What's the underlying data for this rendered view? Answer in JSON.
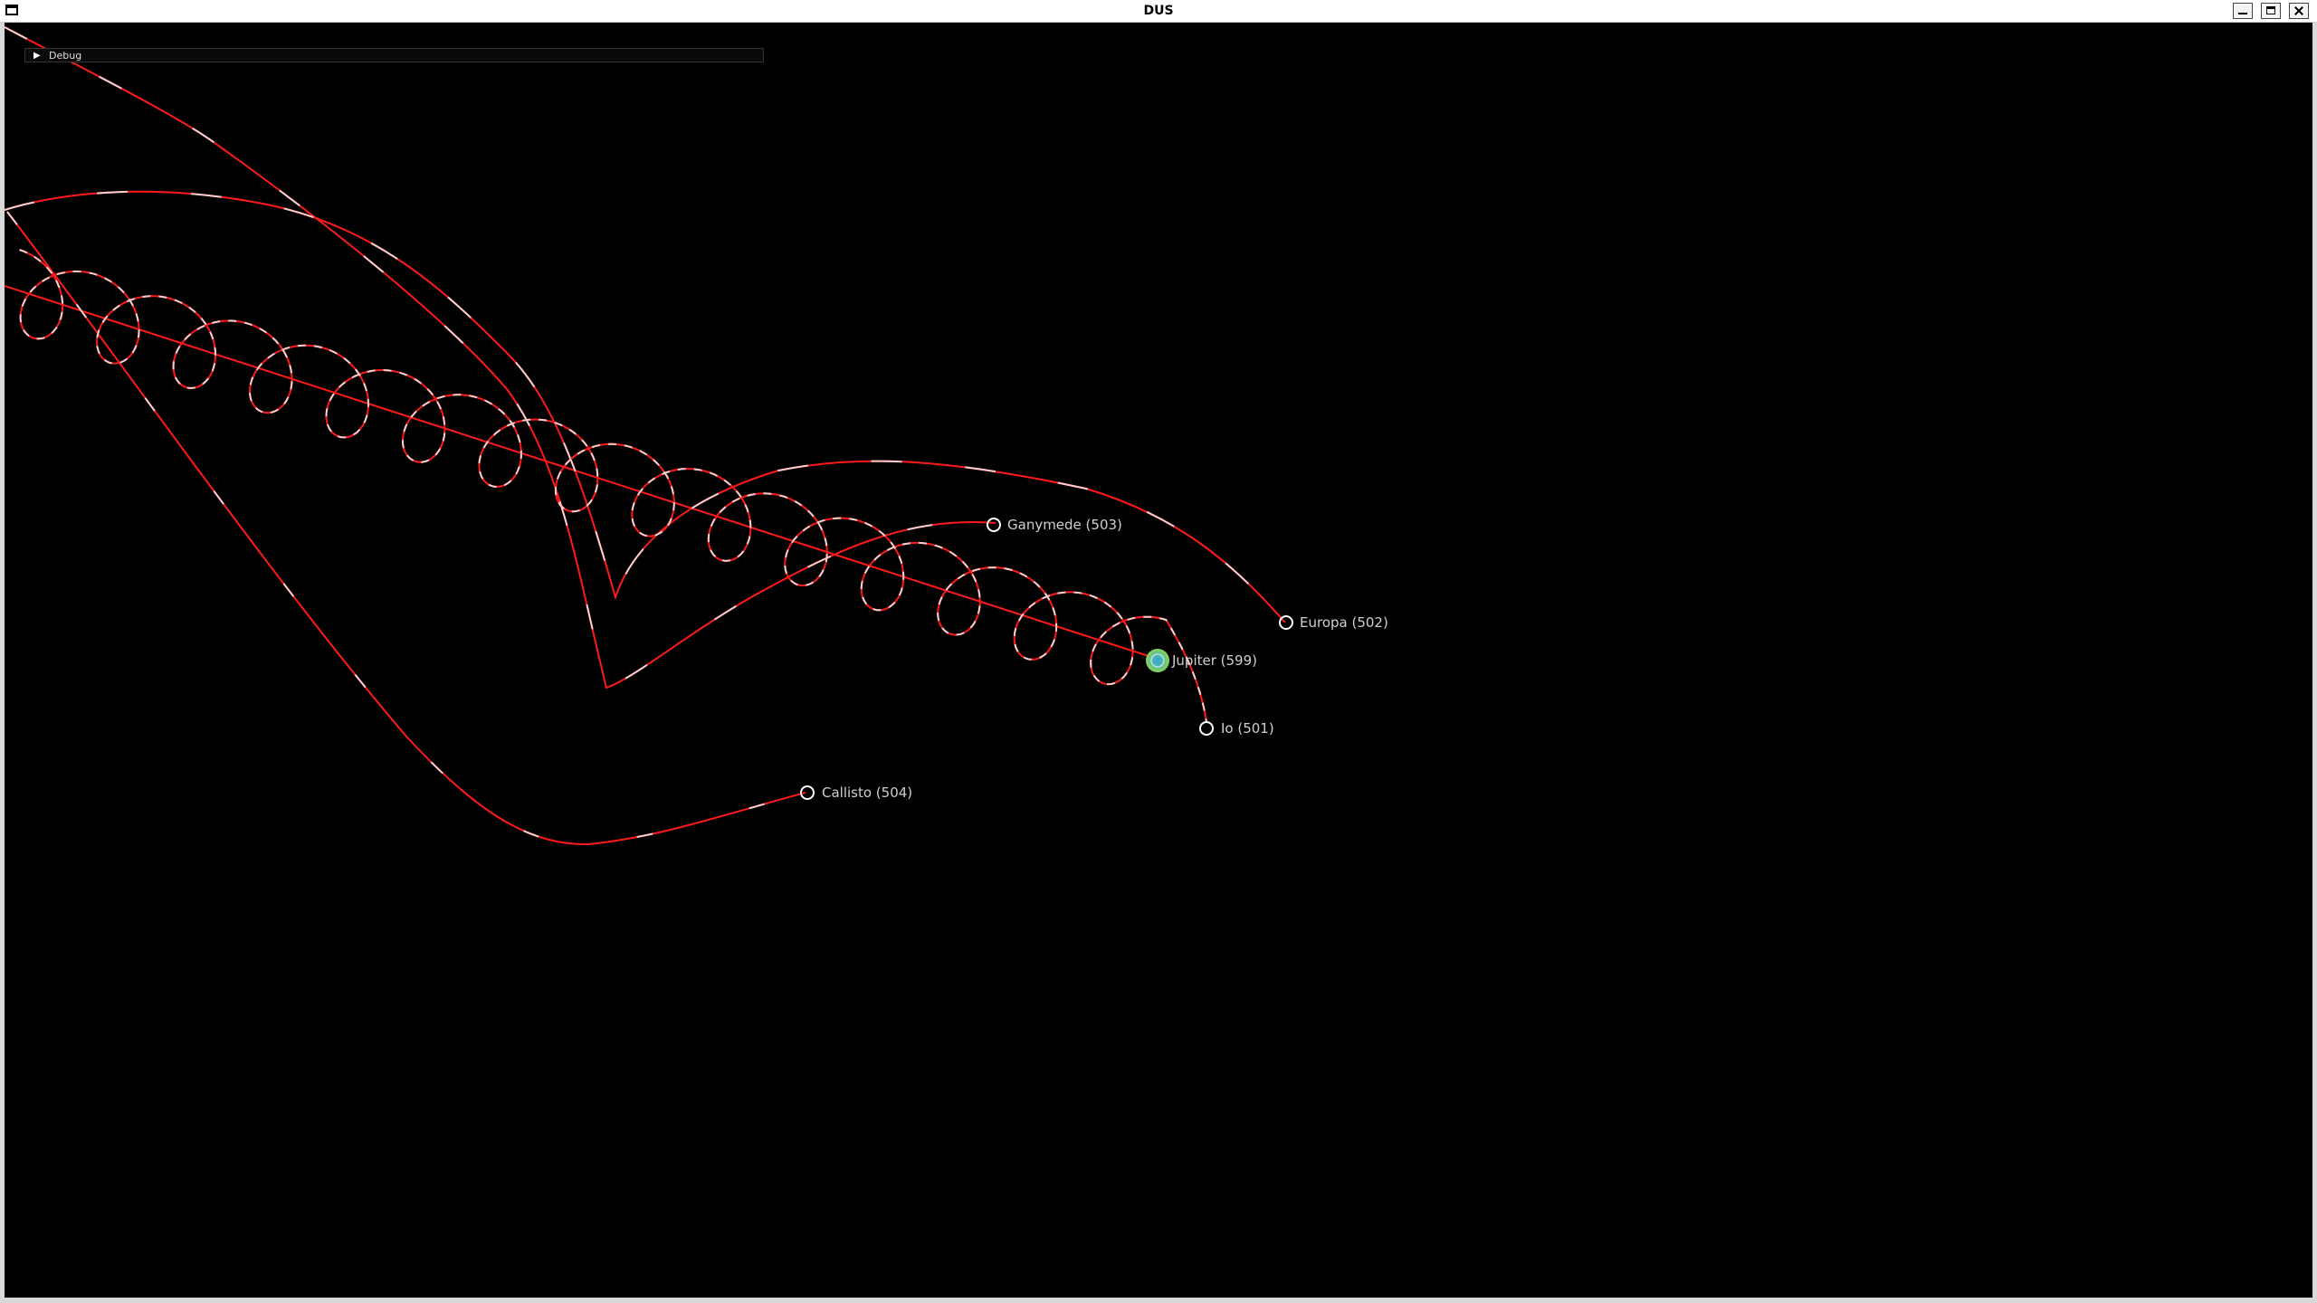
{
  "window": {
    "title": "DUS"
  },
  "debug_panel": {
    "label": "Debug",
    "expand_icon": "triangle-right-icon"
  },
  "colors": {
    "trajectory": "#ff1a1a",
    "trajectory_highlight": "#ffd0d0",
    "marker": "#ffffff",
    "label": "#cfcfcf",
    "jupiter_outer": "#7ad06a",
    "jupiter_inner": "#2fa4e0"
  },
  "bodies": [
    {
      "key": "jupiter",
      "label": "Jupiter (599)"
    },
    {
      "key": "io",
      "label": "Io (501)"
    },
    {
      "key": "europa",
      "label": "Europa (502)"
    },
    {
      "key": "ganymede",
      "label": "Ganymede (503)"
    },
    {
      "key": "callisto",
      "label": "Callisto (504)"
    }
  ]
}
